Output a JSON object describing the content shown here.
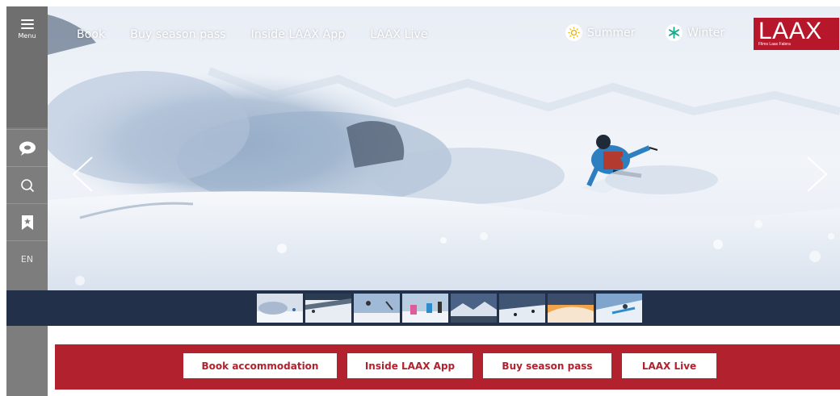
{
  "sidebar": {
    "menu_label": "Menu",
    "language": "EN"
  },
  "nav": {
    "links": [
      "Book",
      "Buy season pass",
      "Inside LAAX App",
      "LAAX Live"
    ]
  },
  "season": {
    "summer": "Summer",
    "winter": "Winter"
  },
  "logo": {
    "text": "LAAX",
    "subtext": "Flims Laax Falera",
    "color": "#b7172b"
  },
  "carousel": {
    "thumbnail_count": 8
  },
  "actions": {
    "buttons": [
      "Book accommodation",
      "Inside LAAX App",
      "Buy season pass",
      "LAAX Live"
    ]
  },
  "colors": {
    "accent": "#b1222e",
    "strip": "#22304a",
    "sidebar": "#7d7d7d"
  }
}
